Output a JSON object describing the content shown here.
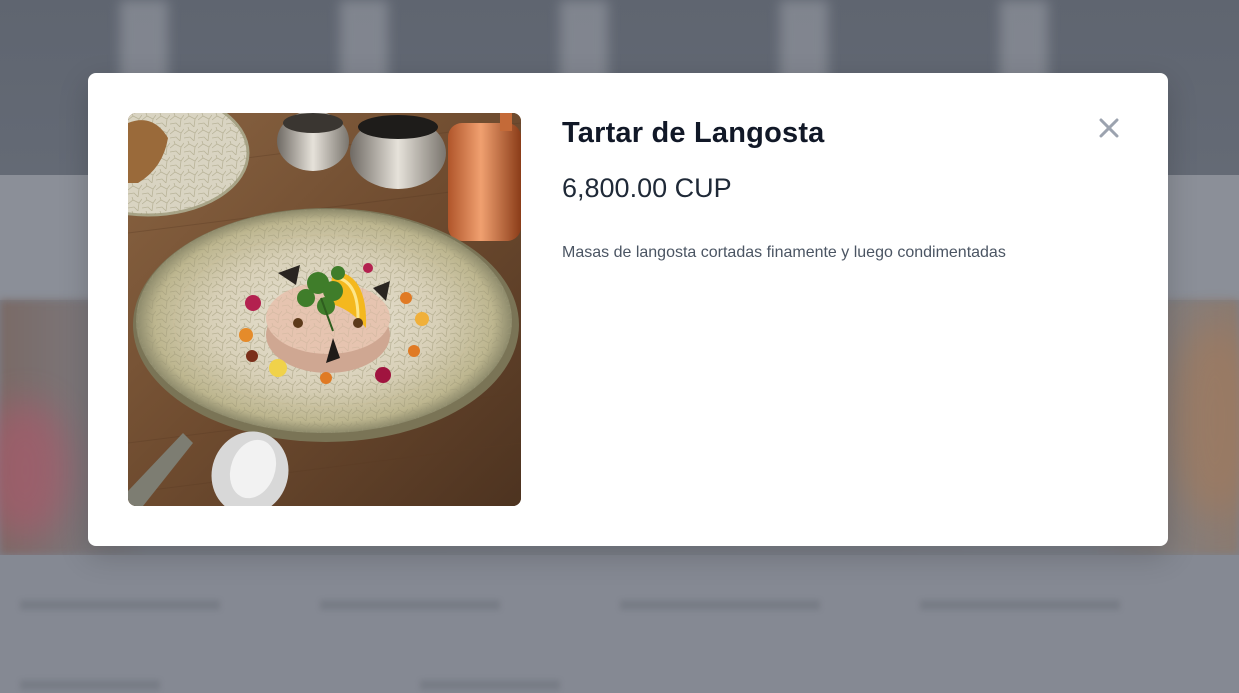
{
  "product": {
    "title": "Tartar de Langosta",
    "price": "6,800.00 CUP",
    "description": "Masas de langosta cortadas finamente y luego condimentadas",
    "image_icon": "food-photo"
  },
  "modal": {
    "close_icon": "close-icon"
  },
  "colors": {
    "title": "#111827",
    "price": "#1f2937",
    "description": "#4b5563",
    "close": "#9ca3af",
    "overlay": "#7d828c"
  }
}
